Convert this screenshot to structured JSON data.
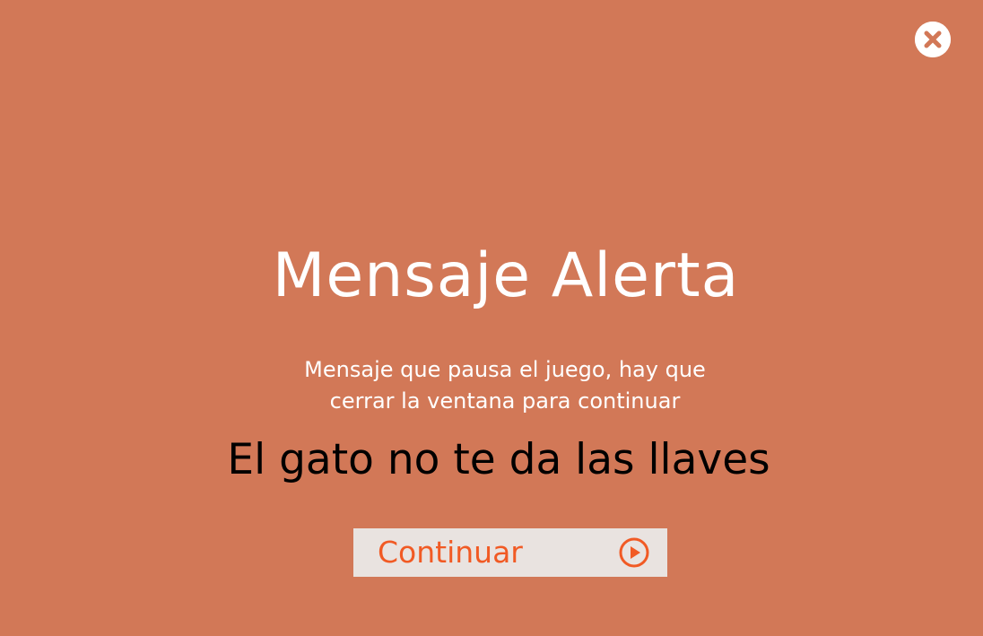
{
  "dialog": {
    "title": "Mensaje Alerta",
    "subtitle": "Mensaje que pausa el juego, hay que\ncerrar la ventana para continuar",
    "message": "El gato no te da las llaves"
  },
  "buttons": {
    "continue_label": "Continuar"
  },
  "icons": {
    "close": "close-icon",
    "continue": "play-icon"
  },
  "colors": {
    "background": "#d27857",
    "close_button": "#ffffff",
    "close_x": "#d27857",
    "button_background": "#e9e3e0",
    "accent": "#f15a24",
    "message_text": "#000000"
  }
}
